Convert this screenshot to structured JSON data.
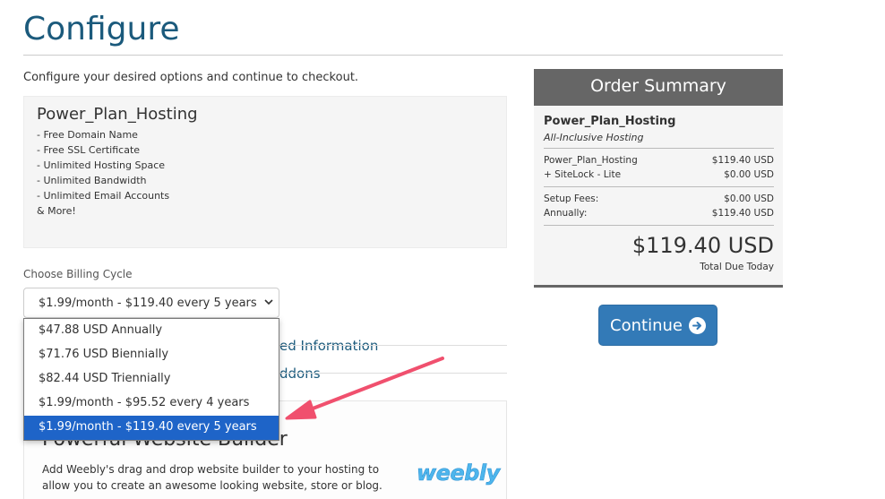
{
  "page": {
    "title": "Configure",
    "intro": "Configure your desired options and continue to checkout."
  },
  "product": {
    "name": "Power_Plan_Hosting",
    "features": [
      "- Free Domain Name",
      "- Free SSL Certificate",
      "- Unlimited Hosting Space",
      "- Unlimited Bandwidth",
      "- Unlimited Email Accounts",
      "& More!"
    ]
  },
  "billing": {
    "label": "Choose Billing Cycle",
    "selected": "$1.99/month - $119.40 every 5 years",
    "options": [
      "$47.88 USD Annually",
      "$71.76 USD Biennially",
      "$82.44 USD Triennially",
      "$1.99/month - $95.52 every 4 years",
      "$1.99/month - $119.40 every 5 years"
    ]
  },
  "sections": {
    "required_info": "ed Information",
    "addons": "ddons"
  },
  "addon": {
    "title": "Powerful Website Builder",
    "description": "Add Weebly's drag and drop website builder to your hosting to allow you to create an awesome looking website, store or blog.",
    "logo": "weebly"
  },
  "summary": {
    "header": "Order Summary",
    "product": "Power_Plan_Hosting",
    "group": "All-Inclusive Hosting",
    "lines": [
      {
        "label": "Power_Plan_Hosting",
        "value": "$119.40 USD"
      },
      {
        "label": "+ SiteLock - Lite",
        "value": "$0.00 USD"
      }
    ],
    "fees": [
      {
        "label": "Setup Fees:",
        "value": "$0.00 USD"
      },
      {
        "label": "Annually:",
        "value": "$119.40 USD"
      }
    ],
    "total": "$119.40 USD",
    "total_label": "Total Due Today"
  },
  "actions": {
    "continue_label": "Continue"
  },
  "colors": {
    "title": "#1b5a7c",
    "selected_option": "#1e64c8",
    "arrow": "#f0506e",
    "button": "#337ab7",
    "summary_header": "#666666"
  }
}
